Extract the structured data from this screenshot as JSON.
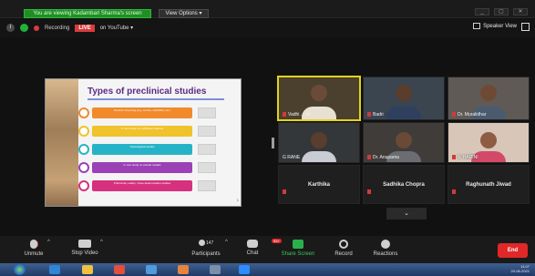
{
  "share_bar": {
    "badge": "You are viewing Kadambari Sharma's screen",
    "view_options": "View Options ▾",
    "right_buttons": [
      "_",
      "▢",
      "✕"
    ]
  },
  "header": {
    "info_glyph": "i",
    "recording": "Recording",
    "live": "LIVE",
    "youtube": "on YouTube ▾",
    "speaker_view": "Speaker View"
  },
  "slide": {
    "title": "Types of preclinical studies",
    "items": [
      {
        "text": "Genetic screening (e.g. mouse, zebrafish, etc.)",
        "color": "#f08a2b"
      },
      {
        "text": "In vitro study on cell/tissue cultures",
        "color": "#f0c22b"
      },
      {
        "text": "Toxicological studies",
        "color": "#27b3c7"
      },
      {
        "text": "In vivo study on animal models",
        "color": "#9b40b5"
      },
      {
        "text": "Preliminary safety / dose determination studies",
        "color": "#d6307e"
      }
    ],
    "page": "1"
  },
  "participants": [
    {
      "name": "Vadhi ... sh",
      "type": "camera",
      "active": true
    },
    {
      "name": "Badri",
      "type": "camera",
      "active": false
    },
    {
      "name": "Dr. Muralidhar",
      "type": "camera",
      "active": false
    },
    {
      "name": "G RANE",
      "type": "camera",
      "active": false
    },
    {
      "name": "Dr. Anupama",
      "type": "camera",
      "active": false
    },
    {
      "name": "V. HARINI",
      "type": "camera",
      "active": false
    },
    {
      "name": "Karthika",
      "type": "name",
      "active": false
    },
    {
      "name": "Sadhika Chopra",
      "type": "name",
      "active": false
    },
    {
      "name": "Raghunath Jiwad",
      "type": "name",
      "active": false
    }
  ],
  "toolbar": {
    "unmute": "Unmute",
    "stop_video": "Stop Video",
    "participants": "Participants",
    "participants_count": "147",
    "chat": "Chat",
    "chat_badge": "99+",
    "share_screen": "Share Screen",
    "record": "Record",
    "reactions": "Reactions",
    "end": "End"
  },
  "taskbar": {
    "time": "11:07",
    "date": "20-06-2021"
  },
  "colors": {
    "accent_green": "#21b13a",
    "live_red": "#d93b3b",
    "end_red": "#e02828",
    "active_speaker": "#e2d31c"
  }
}
